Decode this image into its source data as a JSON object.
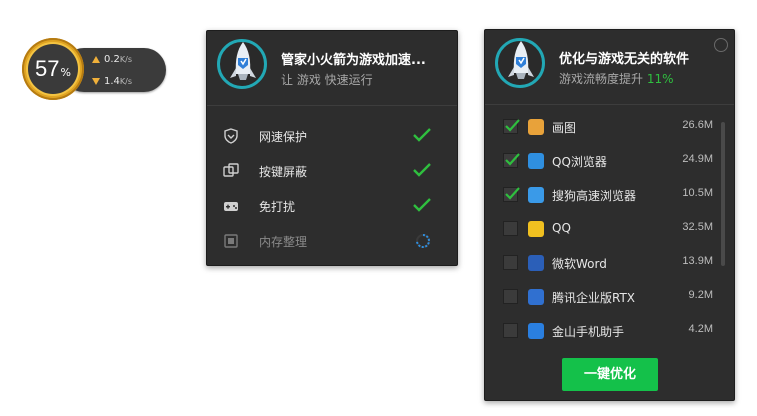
{
  "ball": {
    "percent": "57",
    "percent_symbol": "%",
    "upload": "0.2",
    "download": "1.4",
    "unit": "K/s"
  },
  "accel_panel": {
    "title": "管家小火箭为游戏加速...",
    "subtitle": "让 游戏 快速运行",
    "features": [
      {
        "label": "网速保护",
        "icon": "shield-icon",
        "status": "done"
      },
      {
        "label": "按键屏蔽",
        "icon": "keyboard-block-icon",
        "status": "done"
      },
      {
        "label": "免打扰",
        "icon": "gamepad-icon",
        "status": "done"
      },
      {
        "label": "内存整理",
        "icon": "memory-icon",
        "status": "loading"
      }
    ]
  },
  "optimize_panel": {
    "title": "优化与游戏无关的软件",
    "subtitle_prefix": "游戏流畅度提升 ",
    "subtitle_pct": "11%",
    "apps": [
      {
        "name": "画图",
        "size": "26.6M",
        "checked": true,
        "icon": "paint-icon",
        "color": "#e8a23a"
      },
      {
        "name": "QQ浏览器",
        "size": "24.9M",
        "checked": true,
        "icon": "qq-browser-icon",
        "color": "#2f8fe0"
      },
      {
        "name": "搜狗高速浏览器",
        "size": "10.5M",
        "checked": true,
        "icon": "sogou-browser-icon",
        "color": "#3a9ae8"
      },
      {
        "name": "QQ",
        "size": "32.5M",
        "checked": false,
        "icon": "qq-penguin-icon",
        "color": "#f0c020"
      },
      {
        "name": "微软Word",
        "size": "13.9M",
        "checked": false,
        "icon": "word-icon",
        "color": "#2b5fb8"
      },
      {
        "name": "腾讯企业版RTX",
        "size": "9.2M",
        "checked": false,
        "icon": "rtx-icon",
        "color": "#3070d0"
      },
      {
        "name": "金山手机助手",
        "size": "4.2M",
        "checked": false,
        "icon": "phone-assistant-icon",
        "color": "#2a7fe0"
      }
    ],
    "button_label": "一键优化"
  },
  "colors": {
    "accent_green": "#14c14a",
    "check_green": "#2fbf3f",
    "panel_bg": "#2d2d2d",
    "ring": "#22a8b5"
  }
}
